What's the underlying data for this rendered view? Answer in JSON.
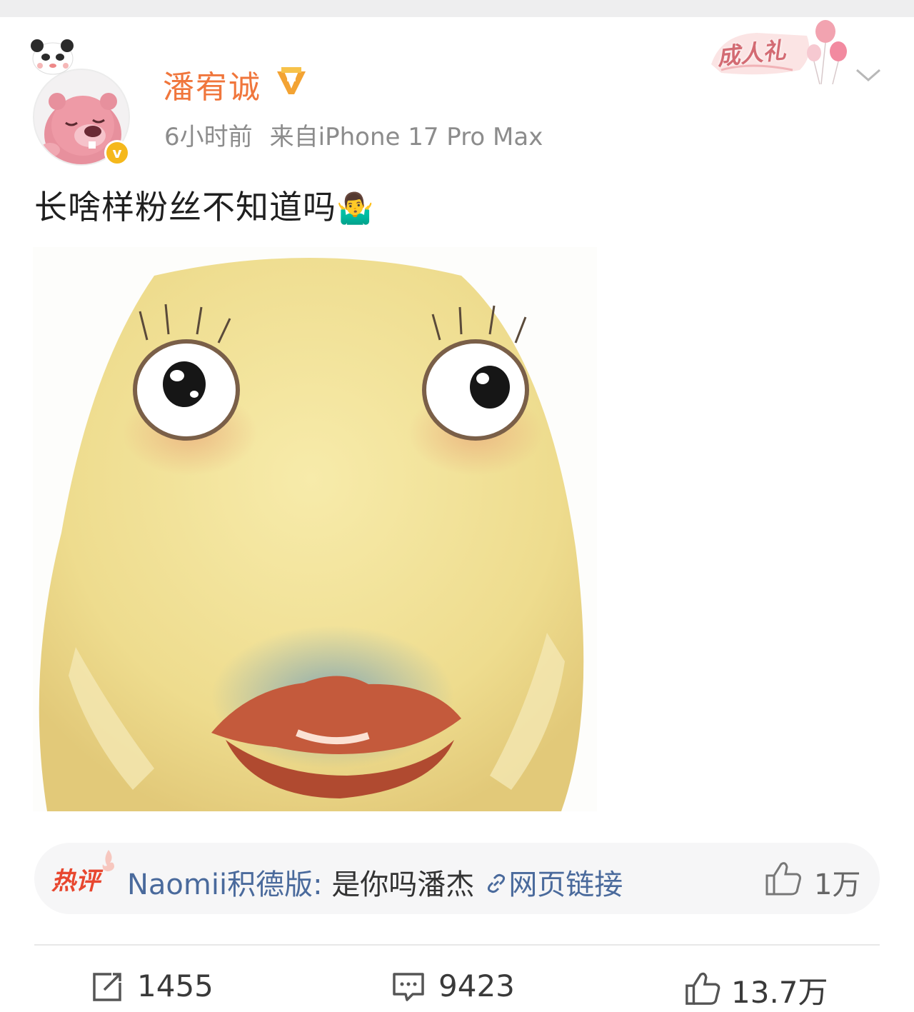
{
  "post": {
    "author": {
      "name": "潘宥诚",
      "verified_badge": "v",
      "avatar_icon": "pink-beaver-avatar"
    },
    "meta": {
      "time": "6小时前",
      "source": "来自iPhone 17 Pro Max"
    },
    "badge": {
      "text": "成人礼",
      "icon": "balloon-badge-icon"
    },
    "text": "长啥样粉丝不知道吗",
    "emoji": "🤷‍♂️",
    "image": {
      "icon": "yellow-cartoon-face-meme"
    }
  },
  "hot_comment": {
    "label": "热评",
    "user": "Naomii积德版",
    "colon": ": ",
    "body": "是你吗潘杰",
    "link_text": "网页链接",
    "like_count": "1万"
  },
  "actions": {
    "repost": "1455",
    "comment": "9423",
    "like": "13.7万"
  },
  "colors": {
    "username": "#f0763c",
    "hot_label": "#e8472f",
    "link": "#4a6a9c",
    "meta": "#8c8c8c"
  }
}
